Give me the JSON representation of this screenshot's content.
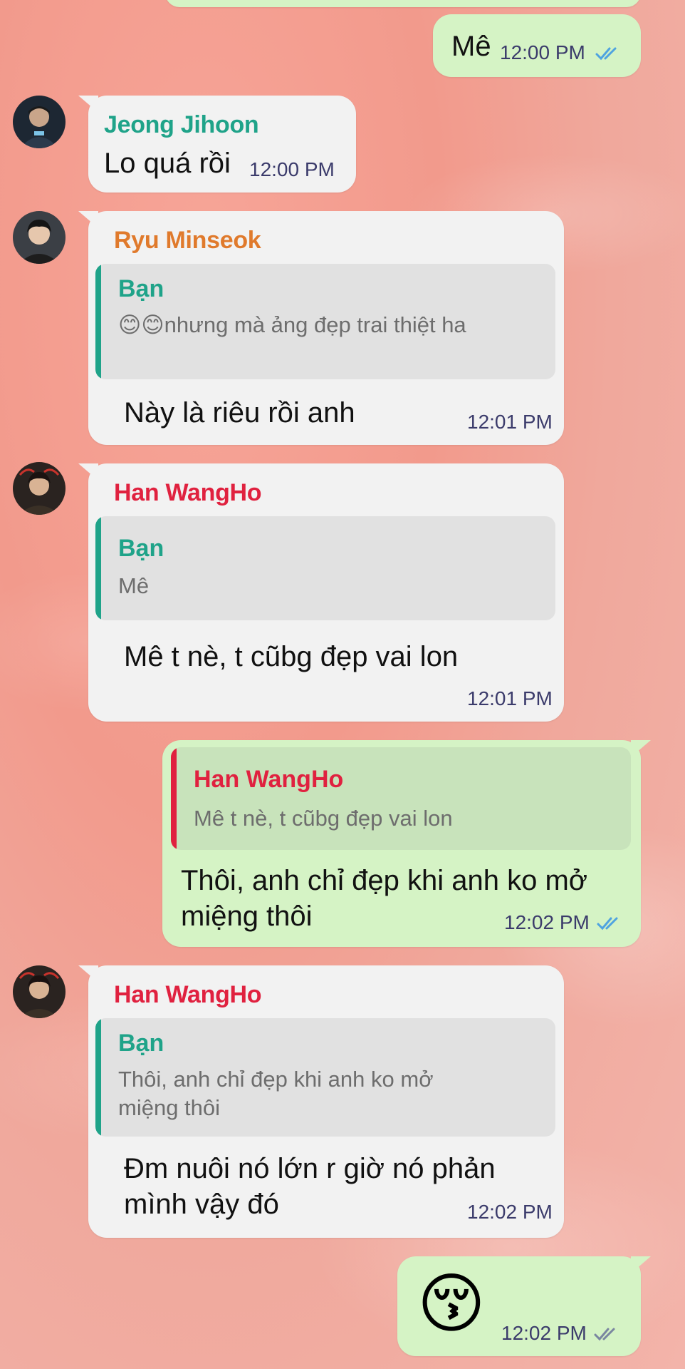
{
  "colors": {
    "incoming_bubble": "#f2f2f2",
    "outgoing_bubble": "#d5f3c5",
    "name_jeong": "#1fa389",
    "name_ryu": "#e07a2c",
    "name_han": "#e0213f",
    "name_ban": "#1fa389",
    "tick_blue": "#4fa3e0"
  },
  "messages": [
    {
      "id": "m1",
      "direction": "out",
      "text": "Mê",
      "time": "12:00 PM",
      "status": "read"
    },
    {
      "id": "m2",
      "direction": "in",
      "sender": "Jeong Jihoon",
      "text": "Lo quá rồi",
      "time": "12:00 PM"
    },
    {
      "id": "m3",
      "direction": "in",
      "sender": "Ryu Minseok",
      "reply_to": {
        "name": "Bạn",
        "text": "😊😊nhưng mà ảng đẹp trai thiệt ha"
      },
      "text": "Này là riêu rồi anh",
      "time": "12:01 PM"
    },
    {
      "id": "m4",
      "direction": "in",
      "sender": "Han WangHo",
      "reply_to": {
        "name": "Bạn",
        "text": "Mê"
      },
      "text": "Mê t nè, t cũbg đẹp vai lon",
      "time": "12:01 PM"
    },
    {
      "id": "m5",
      "direction": "out",
      "reply_to": {
        "name": "Han WangHo",
        "text": "Mê t nè, t cũbg đẹp vai lon"
      },
      "text": "Thôi, anh chỉ đẹp khi anh ko mở miệng thôi",
      "time": "12:02 PM",
      "status": "read"
    },
    {
      "id": "m6",
      "direction": "in",
      "sender": "Han WangHo",
      "reply_to": {
        "name": "Bạn",
        "text": "Thôi, anh chỉ đẹp khi anh ko mở miệng thôi"
      },
      "text": "Đm nuôi nó lớn r giờ nó phản mình vậy đó",
      "time": "12:02 PM"
    },
    {
      "id": "m7",
      "direction": "out",
      "emoji": "😚",
      "time": "12:02 PM",
      "status": "read"
    }
  ]
}
